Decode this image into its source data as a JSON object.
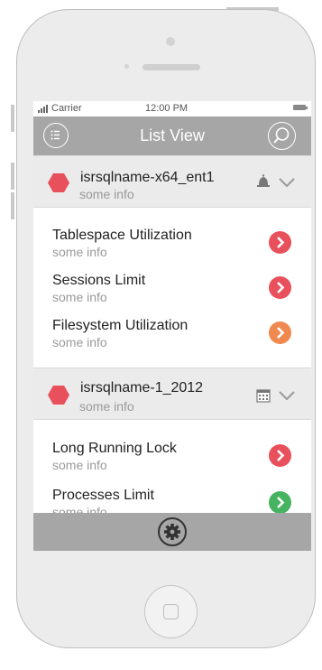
{
  "status_bar": {
    "carrier": "Carrier",
    "time": "12:00 PM"
  },
  "nav": {
    "title": "List View"
  },
  "colors": {
    "nav_bg": "#a6a6a6",
    "critical": "#e8505b",
    "warning": "#f0894f",
    "ok": "#45b35f",
    "group_bg": "#ebebeb"
  },
  "groups": [
    {
      "title": "isrsqlname-x64_ent1",
      "subtitle": "some info",
      "status_color": "#e8505b",
      "icon": "bell-icon",
      "items": [
        {
          "title": "Tablespace Utilization",
          "subtitle": "some info",
          "status": "critical"
        },
        {
          "title": "Sessions Limit",
          "subtitle": "some info",
          "status": "critical"
        },
        {
          "title": "Filesystem Utilization",
          "subtitle": "some info",
          "status": "warning"
        }
      ]
    },
    {
      "title": "isrsqlname-1_2012",
      "subtitle": "some info",
      "status_color": "#e8505b",
      "icon": "calendar-icon",
      "items": [
        {
          "title": "Long Running Lock",
          "subtitle": "some info",
          "status": "critical"
        },
        {
          "title": "Processes Limit",
          "subtitle": "some info",
          "status": "ok"
        }
      ]
    }
  ]
}
